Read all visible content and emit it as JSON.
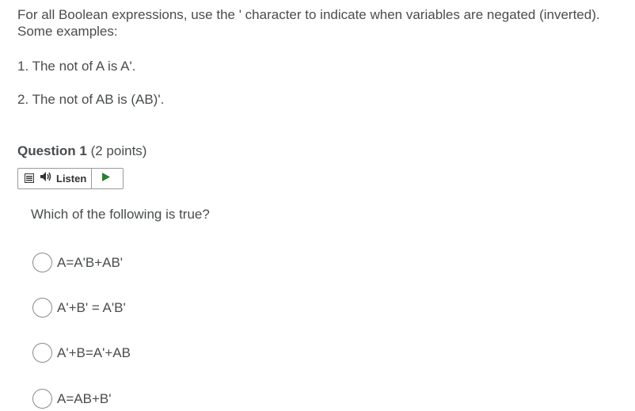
{
  "instructions": {
    "intro": "For all Boolean expressions, use the ' character to indicate when variables are negated (inverted).  Some examples:",
    "examples": [
      "1.  The not of A is A'.",
      "2.  The not of AB is (AB)'."
    ]
  },
  "question": {
    "number_label": "Question 1",
    "points_label": "(2 points)",
    "listen_label": "Listen",
    "prompt": "Which of the following is true?",
    "options": [
      "A=A'B+AB'",
      "A'+B' = A'B'",
      "A'+B=A'+AB",
      "A=AB+B'"
    ]
  },
  "colors": {
    "text": "#494c4e",
    "play_green": "#2e7d32",
    "border": "#9a9a9a"
  },
  "icons": [
    "menu-icon",
    "speaker-icon",
    "play-icon"
  ]
}
